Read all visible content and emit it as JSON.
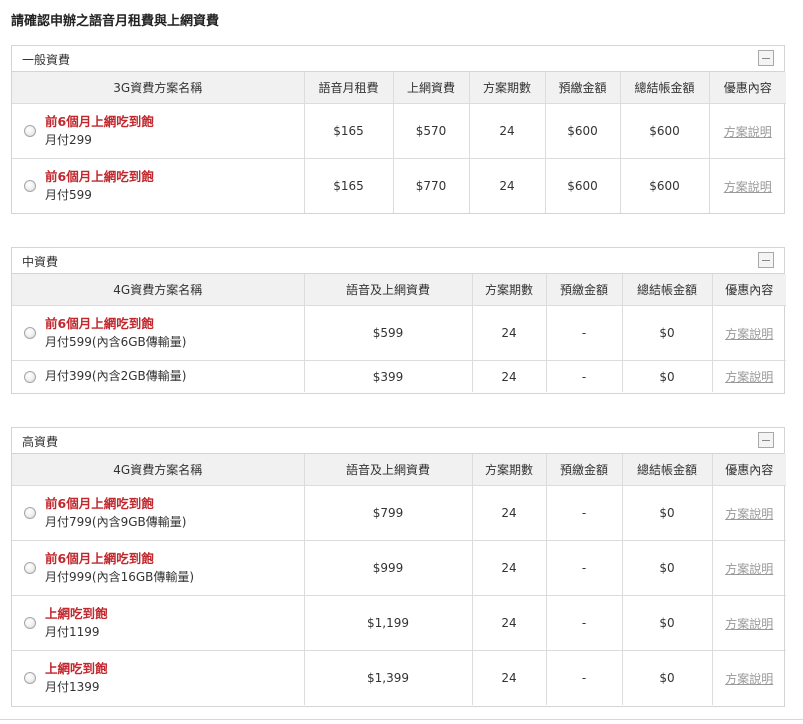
{
  "page": {
    "title": "請確認申辦之語音月租費與上網資費"
  },
  "sections": [
    {
      "title": "一般資費",
      "headers": [
        "3G資費方案名稱",
        "語音月租費",
        "上網資費",
        "方案期數",
        "預繳金額",
        "總結帳金額",
        "優惠內容"
      ],
      "rows": [
        {
          "promo": "前6個月上網吃到飽",
          "plan": "月付299",
          "voice": "$165",
          "data": "$570",
          "period": "24",
          "prepay": "$600",
          "total": "$600",
          "detail": "方案說明"
        },
        {
          "promo": "前6個月上網吃到飽",
          "plan": "月付599",
          "voice": "$165",
          "data": "$770",
          "period": "24",
          "prepay": "$600",
          "total": "$600",
          "detail": "方案說明"
        }
      ]
    },
    {
      "title": "中資費",
      "headers": [
        "4G資費方案名稱",
        "語音及上網資費",
        "方案期數",
        "預繳金額",
        "總結帳金額",
        "優惠內容"
      ],
      "rows": [
        {
          "promo": "前6個月上網吃到飽",
          "plan": "月付599(內含6GB傳輸量)",
          "fee": "$599",
          "period": "24",
          "prepay": "-",
          "total": "$0",
          "detail": "方案說明"
        },
        {
          "promo": "",
          "plan": "月付399(內含2GB傳輸量)",
          "fee": "$399",
          "period": "24",
          "prepay": "-",
          "total": "$0",
          "detail": "方案說明"
        }
      ]
    },
    {
      "title": "高資費",
      "headers": [
        "4G資費方案名稱",
        "語音及上網資費",
        "方案期數",
        "預繳金額",
        "總結帳金額",
        "優惠內容"
      ],
      "rows": [
        {
          "promo": "前6個月上網吃到飽",
          "plan": "月付799(內含9GB傳輸量)",
          "fee": "$799",
          "period": "24",
          "prepay": "-",
          "total": "$0",
          "detail": "方案說明"
        },
        {
          "promo": "前6個月上網吃到飽",
          "plan": "月付999(內含16GB傳輸量)",
          "fee": "$999",
          "period": "24",
          "prepay": "-",
          "total": "$0",
          "detail": "方案說明"
        },
        {
          "promo": "上網吃到飽",
          "plan": "月付1199",
          "fee": "$1,199",
          "period": "24",
          "prepay": "-",
          "total": "$0",
          "detail": "方案說明"
        },
        {
          "promo": "上網吃到飽",
          "plan": "月付1399",
          "fee": "$1,399",
          "period": "24",
          "prepay": "-",
          "total": "$0",
          "detail": "方案說明"
        }
      ]
    }
  ],
  "icons": {
    "collapse": "collapse-minus-icon",
    "radio": "radio-button-icon"
  },
  "colors": {
    "promo": "#c1272d",
    "header_bg": "#f1f1f1",
    "border": "#d4d4d4",
    "link": "#999999"
  }
}
